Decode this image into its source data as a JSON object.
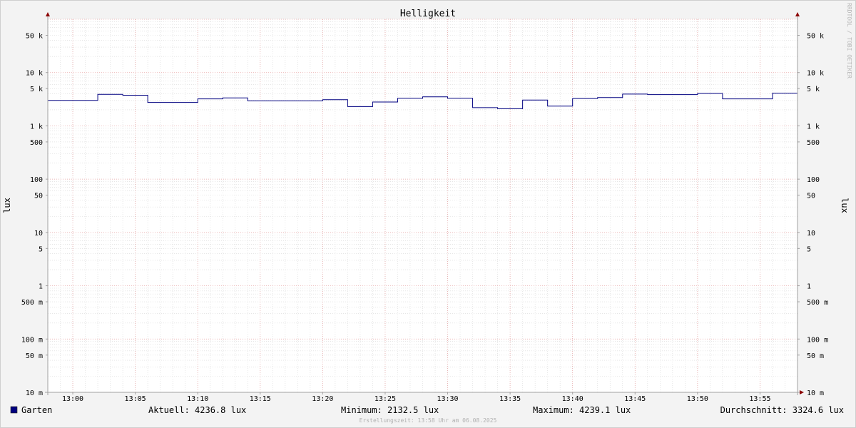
{
  "watermark": "RRDTOOL / TOBI OETIKER",
  "footer": {
    "legend_name": "Garten",
    "current": "Aktuell: 4236.8 lux",
    "minimum": "Minimum: 2132.5 lux",
    "maximum": "Maximum: 4239.1 lux",
    "average": "Durchschnitt: 3324.6 lux",
    "created": "Erstellungszeit: 13:58 Uhr am 06.08.2025"
  },
  "colors": {
    "background": "#f3f3f3",
    "canvas": "#ffffff",
    "series": "#000080",
    "minor_grid": "#d8d8d8",
    "major_grid": "#e6a0a0",
    "axis": "#a0a0a0",
    "arrow": "#8b0000",
    "text": "#000000",
    "faint_text": "#b0b0b0"
  },
  "chart_data": {
    "type": "line",
    "title": "Helligkeit",
    "ylabel": "lux",
    "yscale": "log",
    "ylim": [
      0.01,
      100000
    ],
    "xlim": [
      "12:58",
      "13:58"
    ],
    "grid": true,
    "y_ticks": [
      {
        "value": 0.01,
        "label": "10 m"
      },
      {
        "value": 0.05,
        "label": "50 m"
      },
      {
        "value": 0.1,
        "label": "100 m"
      },
      {
        "value": 0.5,
        "label": "500 m"
      },
      {
        "value": 1,
        "label": "1"
      },
      {
        "value": 5,
        "label": "5"
      },
      {
        "value": 10,
        "label": "10"
      },
      {
        "value": 50,
        "label": "50"
      },
      {
        "value": 100,
        "label": "100"
      },
      {
        "value": 500,
        "label": "500"
      },
      {
        "value": 1000,
        "label": "1 k"
      },
      {
        "value": 5000,
        "label": "5 k"
      },
      {
        "value": 10000,
        "label": "10 k"
      },
      {
        "value": 50000,
        "label": "50 k"
      }
    ],
    "x_ticks": [
      "13:00",
      "13:05",
      "13:10",
      "13:15",
      "13:20",
      "13:25",
      "13:30",
      "13:35",
      "13:40",
      "13:45",
      "13:50",
      "13:55"
    ],
    "series": [
      {
        "name": "Garten",
        "step": true,
        "x": [
          "12:58",
          "13:02",
          "13:04",
          "13:06",
          "13:10",
          "13:12",
          "13:14",
          "13:18",
          "13:20",
          "13:22",
          "13:24",
          "13:26",
          "13:28",
          "13:30",
          "13:32",
          "13:34",
          "13:36",
          "13:38",
          "13:40",
          "13:42",
          "13:44",
          "13:46",
          "13:50",
          "13:52",
          "13:56",
          "13:58"
        ],
        "values": [
          3000,
          3900,
          3750,
          2750,
          3200,
          3350,
          2950,
          2950,
          3100,
          2300,
          2800,
          3300,
          3500,
          3300,
          2200,
          2100,
          3050,
          2350,
          3250,
          3400,
          3950,
          3850,
          4050,
          3200,
          4100,
          4236.8
        ]
      }
    ]
  }
}
